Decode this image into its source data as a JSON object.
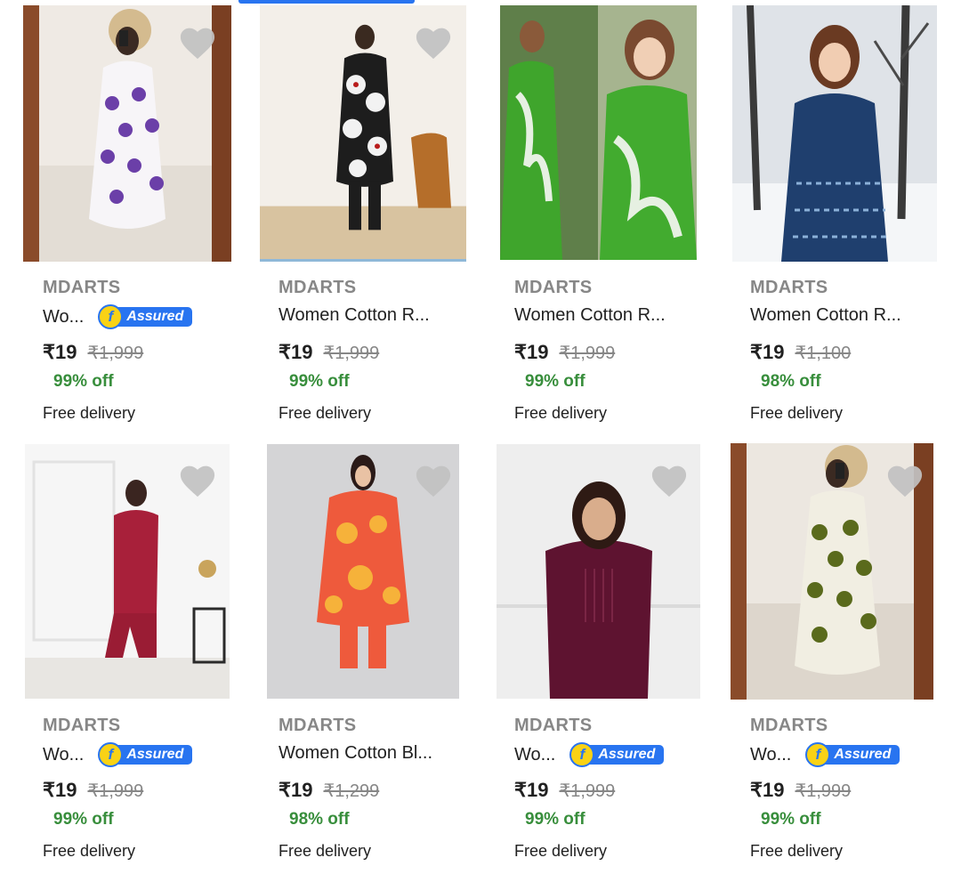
{
  "active_tab_indicator": "#2874f0",
  "colors": {
    "brand_grey": "#878787",
    "discount_green": "#388e3c",
    "assured_blue": "#2874f0",
    "assured_yellow": "#f9d215"
  },
  "products": [
    {
      "brand": "MDARTS",
      "title": "Wo...",
      "assured": true,
      "assured_label": "Assured",
      "price": "₹19",
      "mrp": "₹1,999",
      "discount": "99% off",
      "delivery": "Free delivery",
      "image": "purple-polka-dot-kurta-mirror-selfie"
    },
    {
      "brand": "MDARTS",
      "title": "Women Cotton R...",
      "assured": false,
      "price": "₹19",
      "mrp": "₹1,999",
      "discount": "99% off",
      "delivery": "Free delivery",
      "image": "black-white-floral-kurta-set"
    },
    {
      "brand": "MDARTS",
      "title": "Women Cotton R...",
      "assured": false,
      "price": "₹19",
      "mrp": "₹1,999",
      "discount": "99% off",
      "delivery": "Free delivery",
      "image": "green-printed-co-ord-set"
    },
    {
      "brand": "MDARTS",
      "title": "Women Cotton R...",
      "assured": false,
      "price": "₹19",
      "mrp": "₹1,100",
      "discount": "98% off",
      "delivery": "Free delivery",
      "image": "blue-printed-kurta-snow"
    },
    {
      "brand": "MDARTS",
      "title": "Wo...",
      "assured": true,
      "assured_label": "Assured",
      "price": "₹19",
      "mrp": "₹1,999",
      "discount": "99% off",
      "delivery": "Free delivery",
      "image": "maroon-kurta-dhoti-set"
    },
    {
      "brand": "MDARTS",
      "title": "Women Cotton Bl...",
      "assured": false,
      "price": "₹19",
      "mrp": "₹1,299",
      "discount": "98% off",
      "delivery": "Free delivery",
      "image": "orange-floral-co-ord-set"
    },
    {
      "brand": "MDARTS",
      "title": "Wo...",
      "assured": true,
      "assured_label": "Assured",
      "price": "₹19",
      "mrp": "₹1,999",
      "discount": "99% off",
      "delivery": "Free delivery",
      "image": "wine-pintuck-kurta"
    },
    {
      "brand": "MDARTS",
      "title": "Wo...",
      "assured": true,
      "assured_label": "Assured",
      "price": "₹19",
      "mrp": "₹1,999",
      "discount": "99% off",
      "delivery": "Free delivery",
      "image": "olive-polka-dot-kurta-mirror-selfie"
    }
  ]
}
